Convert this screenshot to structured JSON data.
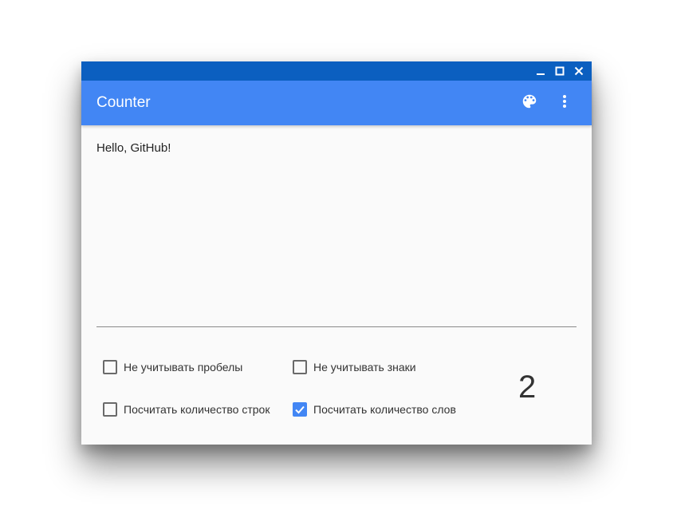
{
  "app": {
    "title": "Counter",
    "accent_color": "#4286f4",
    "titlebar_color": "#0b5fc0"
  },
  "window_controls": [
    "minimize-icon",
    "maximize-icon",
    "close-icon"
  ],
  "appbar_actions": [
    "palette-icon",
    "more-vert-icon"
  ],
  "editor": {
    "value": "Hello, GitHub!"
  },
  "options": {
    "ignore_spaces": {
      "label": "Не учитывать пробелы",
      "checked": false
    },
    "ignore_marks": {
      "label": "Не учитывать знаки",
      "checked": false
    },
    "count_lines": {
      "label": "Посчитать количество строк",
      "checked": false
    },
    "count_words": {
      "label": "Посчитать количество слов",
      "checked": true
    }
  },
  "result": {
    "value": "2"
  }
}
